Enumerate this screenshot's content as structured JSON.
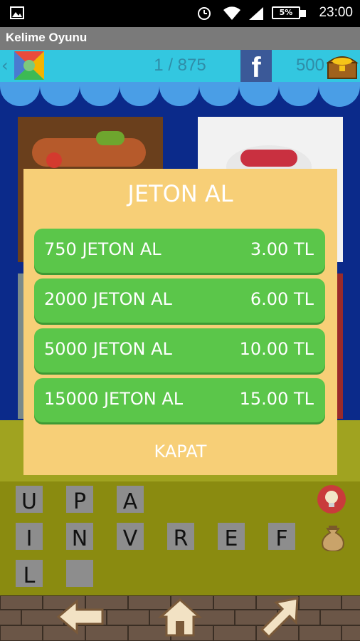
{
  "status_bar": {
    "time": "23:00",
    "battery": "5%"
  },
  "app": {
    "title": "Kelime Oyunu"
  },
  "game_bar": {
    "level": "1 / 875",
    "coins": "500",
    "facebook_glyph": "f"
  },
  "letter_tiles": [
    "U",
    "P",
    "A",
    "I",
    "N",
    "V",
    "R",
    "E",
    "F",
    "L",
    ""
  ],
  "dialog": {
    "title": "JETON AL",
    "offers": [
      {
        "label": "750 JETON AL",
        "price": "3.00 TL"
      },
      {
        "label": "2000 JETON AL",
        "price": "6.00 TL"
      },
      {
        "label": "5000 JETON AL",
        "price": "10.00 TL"
      },
      {
        "label": "15000 JETON AL",
        "price": "15.00 TL"
      }
    ],
    "close_label": "KAPAT"
  },
  "colors": {
    "dialog_bg": "#f7cf77",
    "offer_green": "#5bc64a",
    "top_bar": "#33c7e0",
    "facebook": "#3b5998",
    "board_bg": "#0b2a8a"
  }
}
